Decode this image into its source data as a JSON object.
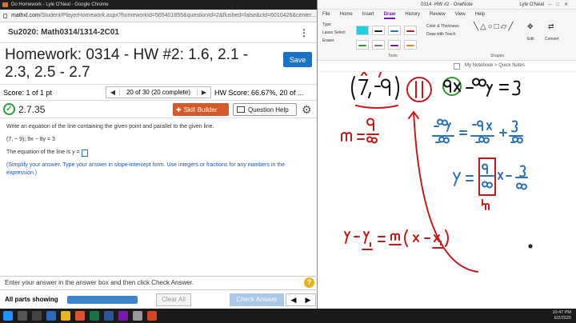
{
  "chrome": {
    "title": "Do Homework - Lyle O'Neal - Google Chrome",
    "url_host": "mathxl.com",
    "url_path": "/Student/PlayerHomework.aspx?homeworkId=565401855&questionId=2&flushed=false&cId=6010426&center..."
  },
  "course": {
    "name": "Su2020: Math0314/1314-2C01"
  },
  "homework": {
    "title": "Homework: 0314 - HW #2: 1.6, 2.1 - 2.3, 2.5 - 2.7",
    "save_label": "Save"
  },
  "score": {
    "label": "Score: 1 of 1 pt",
    "nav_count": "20 of 30 (20 complete)",
    "hw_score": "HW Score: 66.67%, 20 of ..."
  },
  "question": {
    "number": "2.7.35",
    "skill_builder": "Skill Builder",
    "help": "Question Help",
    "prompt": "Write an equation of the line containing the given point and parallel to the given line.",
    "given": "(7, − 9); 9x − 8y = 3",
    "answer_prefix": "The equation of the line is y =",
    "hint": "(Simplify your answer. Type your answer in slope-intercept form. Use integers or fractions for any numbers in the expression.)"
  },
  "footer": {
    "enter_text": "Enter your answer in the answer box and then click Check Answer.",
    "parts": "All parts showing",
    "progress": 1.0,
    "clear_label": "Clear All",
    "check_label": "Check Answer"
  },
  "onenote": {
    "title": "0314 -HW #2 - OneNote",
    "user": "Lyle O'Neal",
    "tabs": [
      "File",
      "Home",
      "Insert",
      "Draw",
      "History",
      "Review",
      "View",
      "Help"
    ],
    "active_tab": "Draw",
    "ribbon": {
      "type": "Type",
      "lasso": "Lasso Select",
      "eraser": "Eraser",
      "color_thickness": "Color & Thickness",
      "draw_touch": "Draw with Touch",
      "edit": "Edit",
      "convert": "Convert",
      "tools": "Tools",
      "shapes": "Shapes"
    },
    "breadcrumb": "My Notebook > Quick Notes"
  },
  "taskbar": {
    "time": "10:47 PM",
    "date": "6/2/2020"
  },
  "colors": {
    "save": "#1a73c8",
    "skill": "#d35a2a",
    "onenote_accent": "#7719aa",
    "ink_red": "#c41a1a",
    "ink_blue": "#2e74b5",
    "ink_green": "#2e9a2e"
  }
}
